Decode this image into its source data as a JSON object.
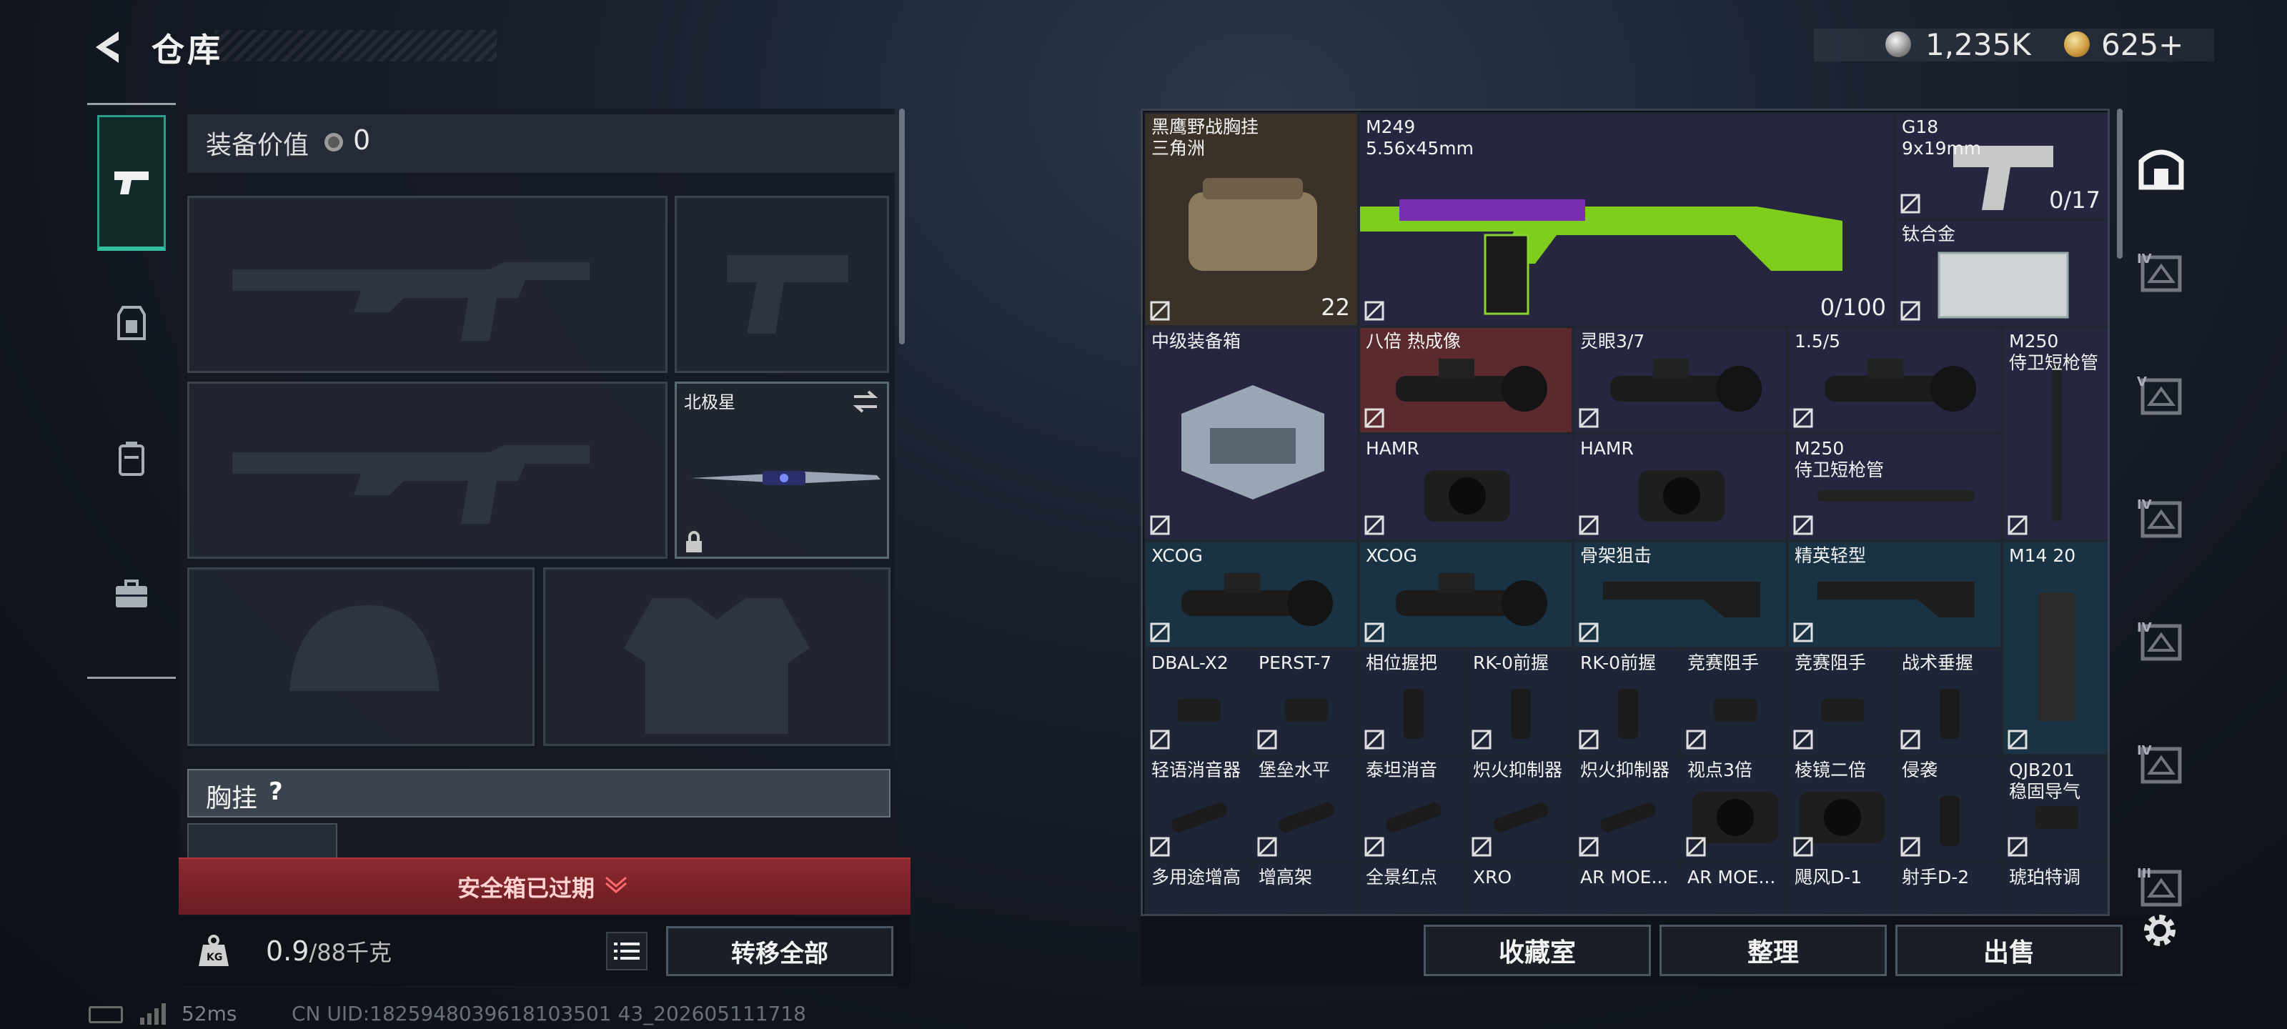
{
  "header": {
    "title": "仓库",
    "currency1": "1,235K",
    "currency2": "625+"
  },
  "equipment": {
    "value_label": "装备价值",
    "value": "0",
    "knife_name": "北极星",
    "chest_label": "胸挂",
    "help": "?"
  },
  "safebox": {
    "status": "安全箱已过期"
  },
  "weight": {
    "current": "0.9",
    "max": "/88千克",
    "transfer_label": "转移全部"
  },
  "status_bar": {
    "ping": "52ms",
    "uid": "CN UID:1825948039618103501 43_202605111718"
  },
  "stash": {
    "items": [
      {
        "name": "黑鹰野战胸挂\n三角洲",
        "count": "22"
      },
      {
        "name": "M249\n5.56x45mm",
        "count": "0/100"
      },
      {
        "name": "G18\n9x19mm",
        "count": "0/17"
      },
      {
        "name": "钛合金"
      },
      {
        "name": "中级装备箱"
      },
      {
        "name": "八倍 热成像"
      },
      {
        "name": "灵眼3/7"
      },
      {
        "name": "1.5/5"
      },
      {
        "name": "M250\n侍卫短枪管"
      },
      {
        "name": "HAMR"
      },
      {
        "name": "HAMR"
      },
      {
        "name": "M250\n侍卫短枪管"
      },
      {
        "name": "XCOG"
      },
      {
        "name": "XCOG"
      },
      {
        "name": "骨架狙击"
      },
      {
        "name": "精英轻型"
      },
      {
        "name": "M14 20"
      },
      {
        "name": "DBAL-X2"
      },
      {
        "name": "PERST-7"
      },
      {
        "name": "相位握把"
      },
      {
        "name": "RK-0前握"
      },
      {
        "name": "RK-0前握"
      },
      {
        "name": "竞赛阻手"
      },
      {
        "name": "竞赛阻手"
      },
      {
        "name": "战术垂握"
      },
      {
        "name": "轻语消音器"
      },
      {
        "name": "堡垒水平"
      },
      {
        "name": "泰坦消音"
      },
      {
        "name": "炽火抑制器"
      },
      {
        "name": "炽火抑制器"
      },
      {
        "name": "视点3倍"
      },
      {
        "name": "棱镜二倍"
      },
      {
        "name": "侵袭"
      },
      {
        "name": "QJB201\n稳固导气"
      },
      {
        "name": "多用途增高"
      },
      {
        "name": "增高架"
      },
      {
        "name": "全景红点"
      },
      {
        "name": "XRO"
      },
      {
        "name": "AR MOE..."
      },
      {
        "name": "AR MOE..."
      },
      {
        "name": "飓风D-1"
      },
      {
        "name": "射手D-2"
      },
      {
        "name": "琥珀特调"
      }
    ]
  },
  "buttons": {
    "collection": "收藏室",
    "sort": "整理",
    "sell": "出售"
  },
  "right_tabs": [
    "IV",
    "V",
    "IV",
    "IV",
    "IV",
    "III"
  ],
  "colors": {
    "accent": "#33c0a2",
    "warning": "#8c2a30",
    "cell_blue": "#1a3344",
    "cell_red": "#5a2a2e"
  }
}
